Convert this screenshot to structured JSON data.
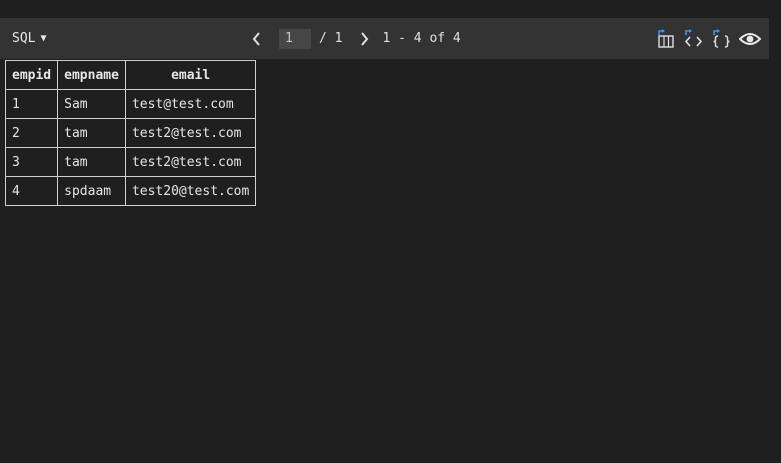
{
  "toolbar": {
    "language_label": "SQL",
    "caret": "▼",
    "page_value": "1",
    "page_total": "/ 1",
    "range_text": "1 - 4 of 4",
    "icons": [
      "prev-page-icon",
      "next-page-icon",
      "export-csv-icon",
      "export-html-icon",
      "export-json-icon",
      "preview-eye-icon"
    ],
    "accent_color": "#3794ff"
  },
  "table": {
    "columns": [
      "empid",
      "empname",
      "email"
    ],
    "rows": [
      [
        "1",
        "Sam",
        "test@test.com"
      ],
      [
        "2",
        "tam",
        "test2@test.com"
      ],
      [
        "3",
        "tam",
        "test2@test.com"
      ],
      [
        "4",
        "spdaam",
        "test20@test.com"
      ]
    ]
  }
}
